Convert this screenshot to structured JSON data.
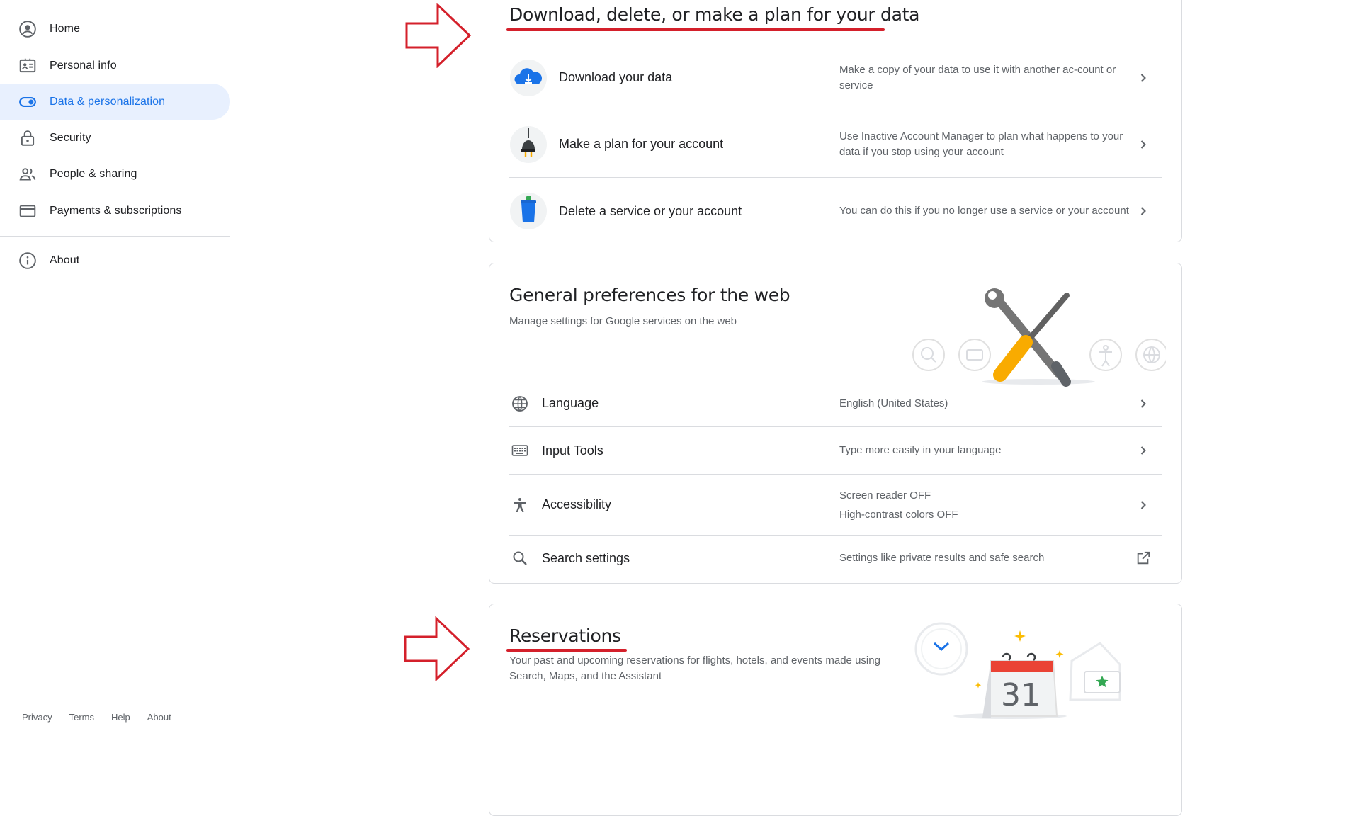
{
  "sidebar": {
    "items": [
      {
        "label": "Home",
        "icon": "account-circle-icon"
      },
      {
        "label": "Personal info",
        "icon": "id-card-icon"
      },
      {
        "label": "Data & personalization",
        "icon": "toggle-icon",
        "active": true
      },
      {
        "label": "Security",
        "icon": "lock-icon"
      },
      {
        "label": "People & sharing",
        "icon": "people-icon"
      },
      {
        "label": "Payments & subscriptions",
        "icon": "credit-card-icon"
      }
    ],
    "about": {
      "label": "About",
      "icon": "info-icon"
    },
    "footer": [
      "Privacy",
      "Terms",
      "Help",
      "About"
    ]
  },
  "data_card": {
    "title": "Download, delete, or make a plan for your data",
    "rows": [
      {
        "title": "Download your data",
        "value": "Make a copy of your data to use it with another ac-count or service",
        "icon": "cloud-download-icon"
      },
      {
        "title": "Make a plan for your account",
        "value": "Use Inactive Account Manager to plan what happens to your data if you stop using your account",
        "icon": "plug-icon"
      },
      {
        "title": "Delete a service or your account",
        "value": "You can do this if you no longer use a service or your account",
        "icon": "trash-can-icon"
      }
    ]
  },
  "prefs_card": {
    "title": "General preferences for the web",
    "desc": "Manage settings for Google services on the web",
    "rows": [
      {
        "title": "Language",
        "value": "English (United States)",
        "icon": "globe-icon",
        "action": "chevron"
      },
      {
        "title": "Input Tools",
        "value": "Type more easily in your language",
        "icon": "keyboard-icon",
        "action": "chevron"
      },
      {
        "title": "Accessibility",
        "value_lines": [
          "Screen reader OFF",
          "High-contrast colors OFF"
        ],
        "icon": "accessibility-icon",
        "action": "chevron"
      },
      {
        "title": "Search settings",
        "value": "Settings like private results and safe search",
        "icon": "search-icon",
        "action": "external-link"
      }
    ]
  },
  "reservations_card": {
    "title": "Reservations",
    "desc": "Your past and upcoming reservations for flights, hotels, and events made using Search, Maps, and the Assistant",
    "calendar_day": "31"
  },
  "colors": {
    "accent": "#1a73e8",
    "active_bg": "#e8f0fe",
    "annotation_red": "#d4202b"
  }
}
